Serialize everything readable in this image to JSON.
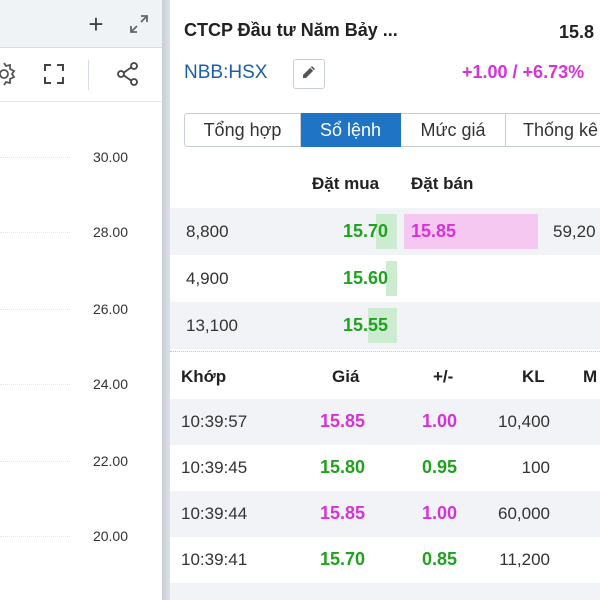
{
  "chart_panel": {
    "y_ticks": [
      "30.00",
      "28.00",
      "26.00",
      "24.00",
      "22.00",
      "20.00"
    ]
  },
  "header": {
    "company_name": "CTCP Đầu tư Năm Bảy ...",
    "last_price": "15.8",
    "ticker": "NBB:HSX",
    "change": "+1.00 / +6.73%"
  },
  "tabs": [
    {
      "label": "Tổng hợp"
    },
    {
      "label": "Sổ lệnh"
    },
    {
      "label": "Mức giá"
    },
    {
      "label": "Thống kê"
    }
  ],
  "order_book": {
    "buy_header": "Đặt mua",
    "sell_header": "Đặt bán",
    "rows": [
      {
        "bid_volume": "8,800",
        "bid_price": "15.70",
        "ask_price": "15.85",
        "ask_volume": "59,20"
      },
      {
        "bid_volume": "4,900",
        "bid_price": "15.60",
        "ask_price": "",
        "ask_volume": ""
      },
      {
        "bid_volume": "13,100",
        "bid_price": "15.55",
        "ask_price": "",
        "ask_volume": ""
      }
    ]
  },
  "trades": {
    "headers": [
      "Khớp",
      "Giá",
      "+/-",
      "KL",
      "M"
    ],
    "rows": [
      {
        "time": "10:39:57",
        "price": "15.85",
        "change": "1.00",
        "volume": "10,400",
        "price_color": "magenta",
        "change_color": "magenta"
      },
      {
        "time": "10:39:45",
        "price": "15.80",
        "change": "0.95",
        "volume": "100",
        "price_color": "green",
        "change_color": "green"
      },
      {
        "time": "10:39:44",
        "price": "15.85",
        "change": "1.00",
        "volume": "60,000",
        "price_color": "magenta",
        "change_color": "magenta"
      },
      {
        "time": "10:39:41",
        "price": "15.70",
        "change": "0.85",
        "volume": "11,200",
        "price_color": "green",
        "change_color": "green"
      }
    ]
  },
  "colors": {
    "up_magenta": "#d633d6",
    "up_green": "#1fa31f",
    "accent_blue": "#1f74c6",
    "ticker_blue": "#1a5fa8"
  },
  "icons": [
    "plus-icon",
    "expand-icon",
    "gear-icon",
    "fullscreen-icon",
    "share-icon",
    "pencil-icon"
  ]
}
